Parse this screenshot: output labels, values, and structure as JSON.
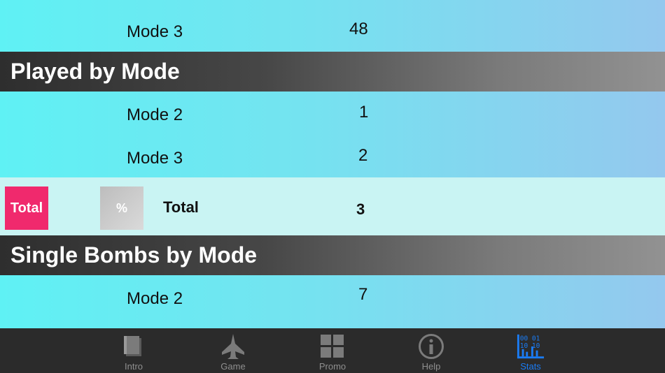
{
  "sections": {
    "top_row": {
      "mode": "Mode 3",
      "value": "48"
    },
    "played": {
      "title": "Played by Mode",
      "rows": [
        {
          "mode": "Mode 2",
          "value": "1"
        },
        {
          "mode": "Mode 3",
          "value": "2"
        }
      ]
    },
    "total_row": {
      "total_button": "Total",
      "percent_button": "%",
      "label": "Total",
      "value": "3"
    },
    "single_bombs": {
      "title": "Single Bombs by Mode",
      "rows": [
        {
          "mode": "Mode 2",
          "value": "7"
        }
      ]
    }
  },
  "tabbar": {
    "items": [
      {
        "label": "Intro",
        "icon": "book-icon"
      },
      {
        "label": "Game",
        "icon": "jet-icon"
      },
      {
        "label": "Promo",
        "icon": "grid-icon"
      },
      {
        "label": "Help",
        "icon": "info-icon"
      },
      {
        "label": "Stats",
        "icon": "stats-icon"
      }
    ],
    "active": "Stats",
    "active_color": "#1a7cf5",
    "stats_icon_digits": [
      "00",
      "01",
      "10",
      "10"
    ]
  },
  "colors": {
    "total_button": "#f0296d",
    "header_dark": "#2e2e2e",
    "total_row_bg": "#c9f4f3"
  }
}
